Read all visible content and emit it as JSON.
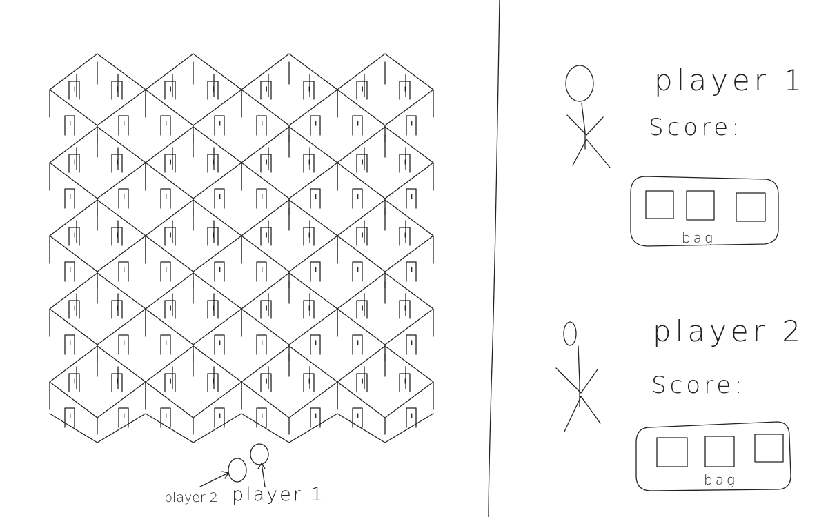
{
  "board": {
    "columns": 4,
    "rows": 5,
    "ink_color": "#222222",
    "background": "#ffffff"
  },
  "tokens": [
    {
      "id": "player2",
      "label": "player 2"
    },
    {
      "id": "player1",
      "label": "player 1"
    }
  ],
  "players": [
    {
      "name": "player 1",
      "score_label": "Score:",
      "bag_label": "bag",
      "bag_slots": 3
    },
    {
      "name": "player 2",
      "score_label": "Score:",
      "bag_label": "bag",
      "bag_slots": 3
    }
  ]
}
